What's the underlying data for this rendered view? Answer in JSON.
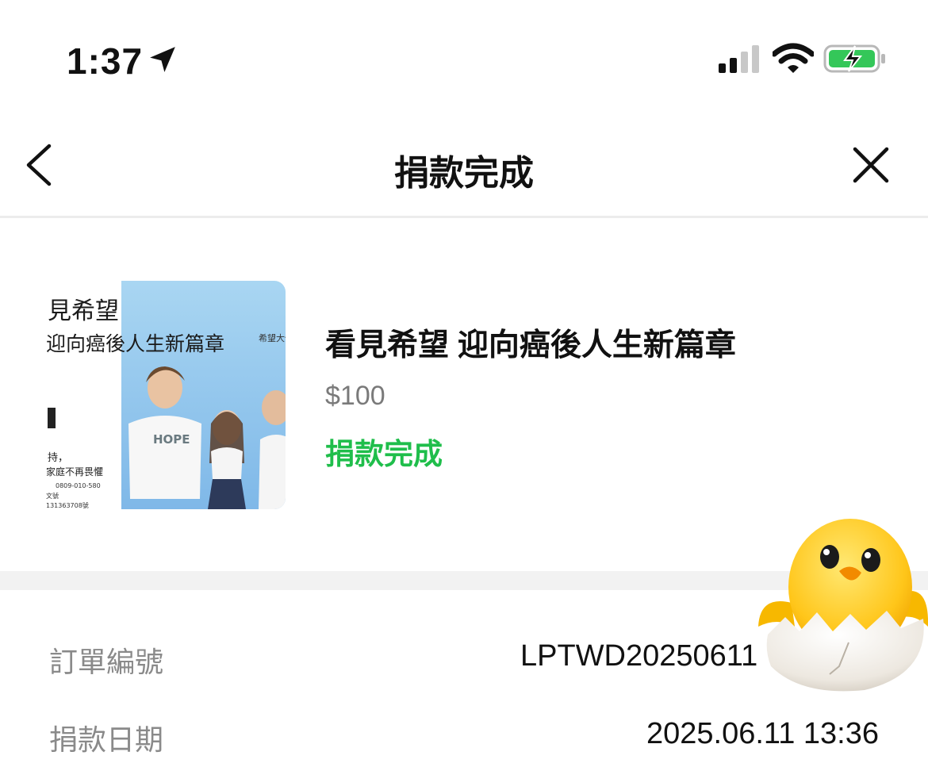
{
  "status_bar": {
    "time": "1:37"
  },
  "nav": {
    "title": "捐款完成"
  },
  "campaign": {
    "title": "看見希望 迎向癌後人生新篇章",
    "amount": "$100",
    "status": "捐款完成",
    "poster": {
      "headline_line1": "見希望",
      "headline_line2": "迎向癌後人生新篇章",
      "ambassador_label": "希望大使",
      "shirt_text": "HOPE",
      "side_text_line1": "持，",
      "side_text_line2": "家庭不再畏懼",
      "phone": "0809-010-580",
      "doc_label": "文號",
      "doc_number": "131363708號"
    }
  },
  "details": {
    "order_number_label": "訂單編號",
    "order_number_value": "LPTWD20250611",
    "donation_date_label": "捐款日期",
    "donation_date_value": "2025.06.11 13:36"
  },
  "colors": {
    "accent_green": "#1fbe4b",
    "label_gray": "#8a8a8a",
    "divider": "#f2f2f2",
    "battery_green": "#34c759"
  },
  "icons": {
    "back": "chevron-left-icon",
    "close": "close-icon",
    "location": "location-arrow-icon",
    "signal": "cellular-signal-icon",
    "wifi": "wifi-icon",
    "battery": "battery-charging-icon"
  }
}
